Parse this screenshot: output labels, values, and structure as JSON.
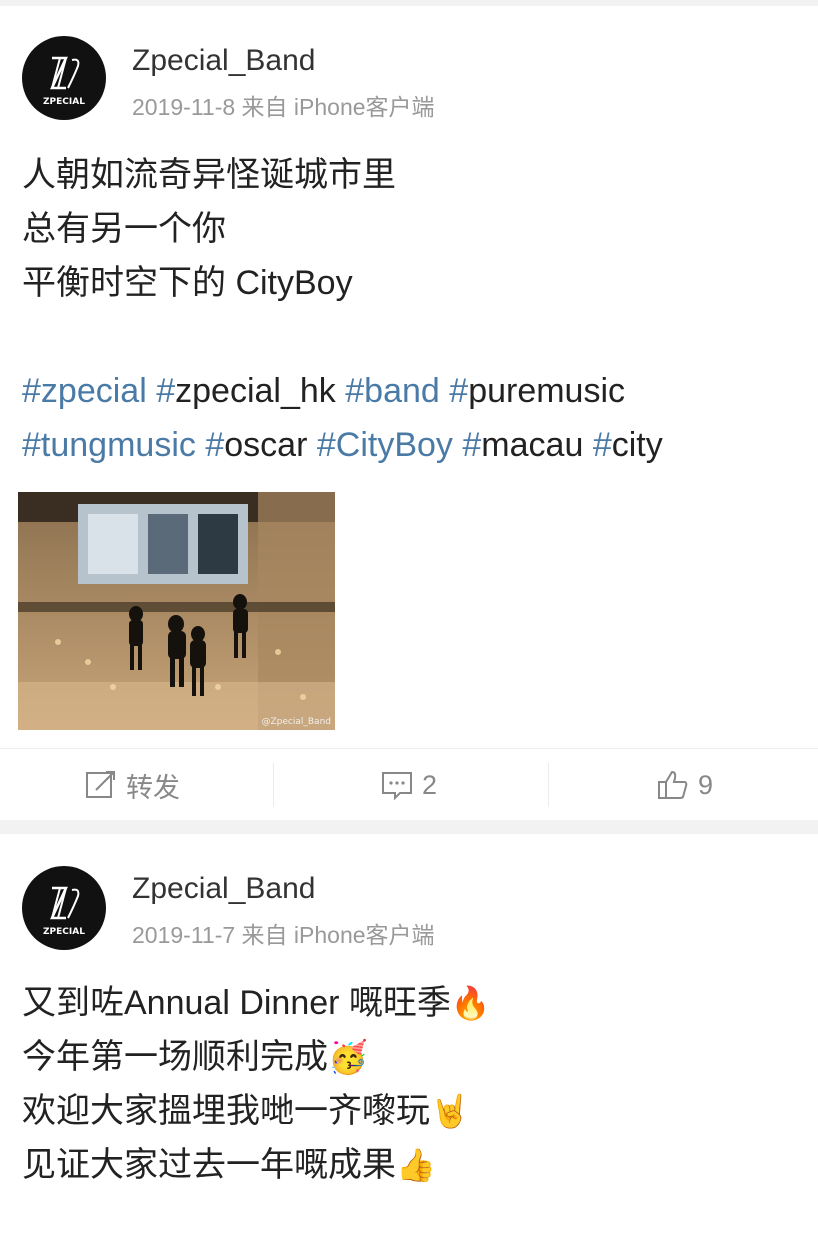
{
  "posts": [
    {
      "author": "Zpecial_Band",
      "avatar_text": "ZPECIAL",
      "meta": "2019-11-8 来自 iPhone客户端",
      "lines": [
        "人朝如流奇异怪诞城市里",
        "总有另一个你",
        "平衡时空下的 CityBoy"
      ],
      "tags_line1": [
        {
          "hash": "#",
          "text": "zpecial",
          "full": true
        },
        {
          "hash": "#",
          "text": "zpecial_hk",
          "full": false
        },
        {
          "hash": "#",
          "text": "band",
          "full": true
        },
        {
          "hash": "#",
          "text": "puremusic",
          "full": false
        }
      ],
      "tags_line2": [
        {
          "hash": "#",
          "text": "tungmusic",
          "full": true
        },
        {
          "hash": "#",
          "text": "oscar",
          "full": false
        },
        {
          "hash": "#",
          "text": "CityBoy",
          "full": true
        },
        {
          "hash": "#",
          "text": "macau",
          "full": false
        },
        {
          "hash": "#",
          "text": "city",
          "full": false
        }
      ],
      "photo_watermark": "@Zpecial_Band",
      "actions": {
        "repost": "转发",
        "comments": "2",
        "likes": "9"
      }
    },
    {
      "author": "Zpecial_Band",
      "avatar_text": "ZPECIAL",
      "meta": "2019-11-7 来自 iPhone客户端",
      "lines": [
        "又到咗Annual Dinner 嘅旺季",
        "今年第一场顺利完成",
        "欢迎大家搵埋我哋一齐嚟玩",
        "见证大家过去一年嘅成果"
      ],
      "emojis": [
        "🔥",
        "🥳",
        "🤘",
        "👍"
      ]
    }
  ],
  "colors": {
    "link": "#4a7aa6",
    "meta": "#999999",
    "background": "#f2f2f2"
  }
}
